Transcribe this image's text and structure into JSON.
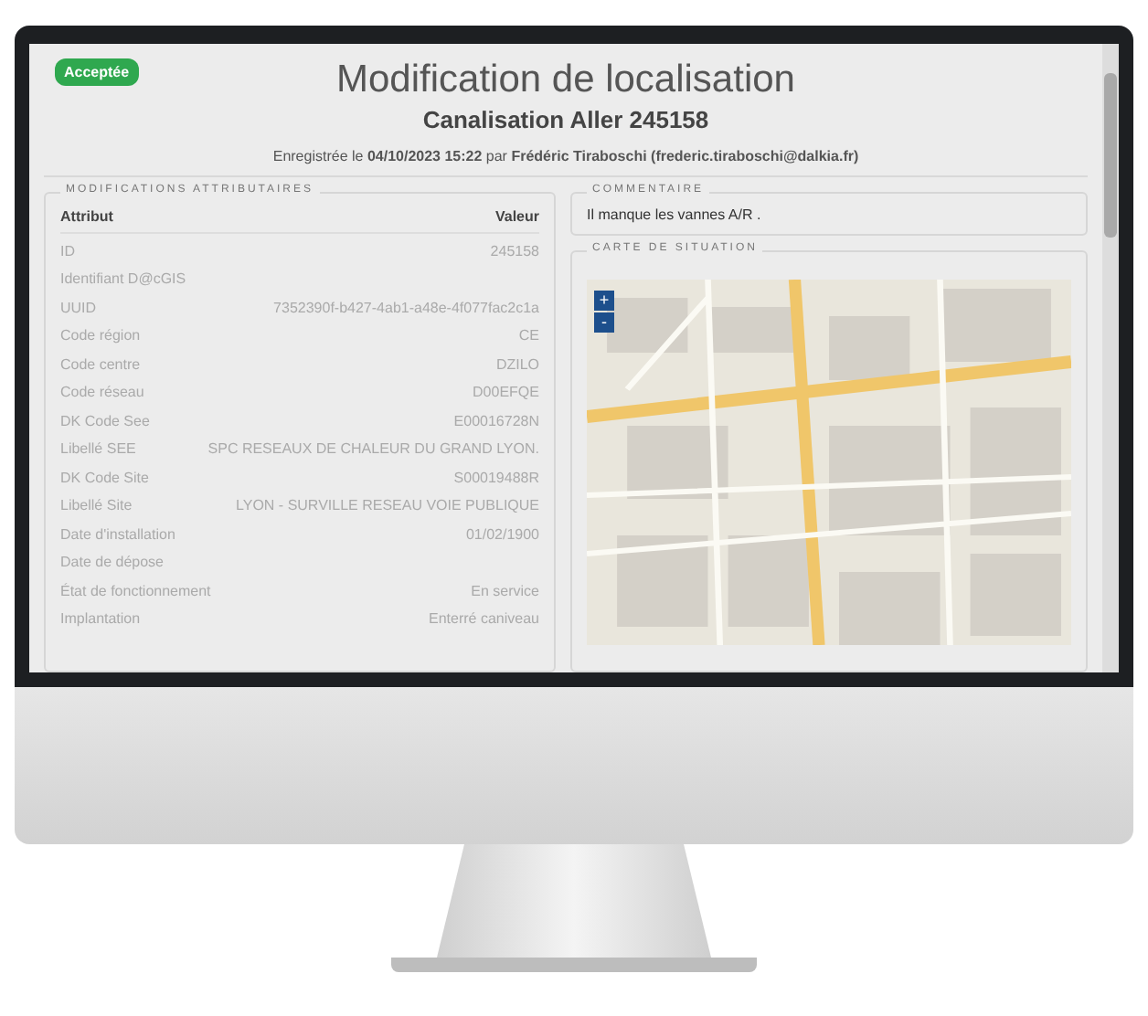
{
  "status_badge": "Acceptée",
  "title": "Modification de localisation",
  "subtitle": "Canalisation Aller 245158",
  "meta": "Enregistrée le **04/10/2023 15:22** par **Frédéric Tiraboschi (frederic.tiraboschi@dalkia.fr)**",
  "attributes": {
    "legend": "MODIFICATIONS ATTRIBUTAIRES",
    "columns": [
      "Attribut",
      "Valeur"
    ],
    "rows": [
      [
        "ID",
        "245158"
      ],
      [
        "Identifiant D@cGIS",
        ""
      ],
      [
        "UUID",
        "7352390f-b427-4ab1-a48e-4f077fac2c1a"
      ],
      [
        "Code région",
        "CE"
      ],
      [
        "Code centre",
        "DZILO"
      ],
      [
        "Code réseau",
        "D00EFQE"
      ],
      [
        "DK Code See",
        "E00016728N"
      ],
      [
        "Libellé SEE",
        "SPC RESEAUX DE CHALEUR DU GRAND LYON."
      ],
      [
        "DK Code Site",
        "S00019488R"
      ],
      [
        "Libellé Site",
        "LYON - SURVILLE RESEAU VOIE PUBLIQUE"
      ],
      [
        "Date d'installation",
        "01/02/1900"
      ],
      [
        "Date de dépose",
        ""
      ],
      [
        "État de fonctionnement",
        "En service"
      ],
      [
        "Implantation",
        "Enterré caniveau"
      ]
    ]
  },
  "comment": {
    "legend": "COMMENTAIRE",
    "text": "Il manque les vannes A/R ."
  },
  "map": {
    "legend": "CARTE DE SITUATION",
    "zoom_in": "+",
    "zoom_out": "-"
  }
}
